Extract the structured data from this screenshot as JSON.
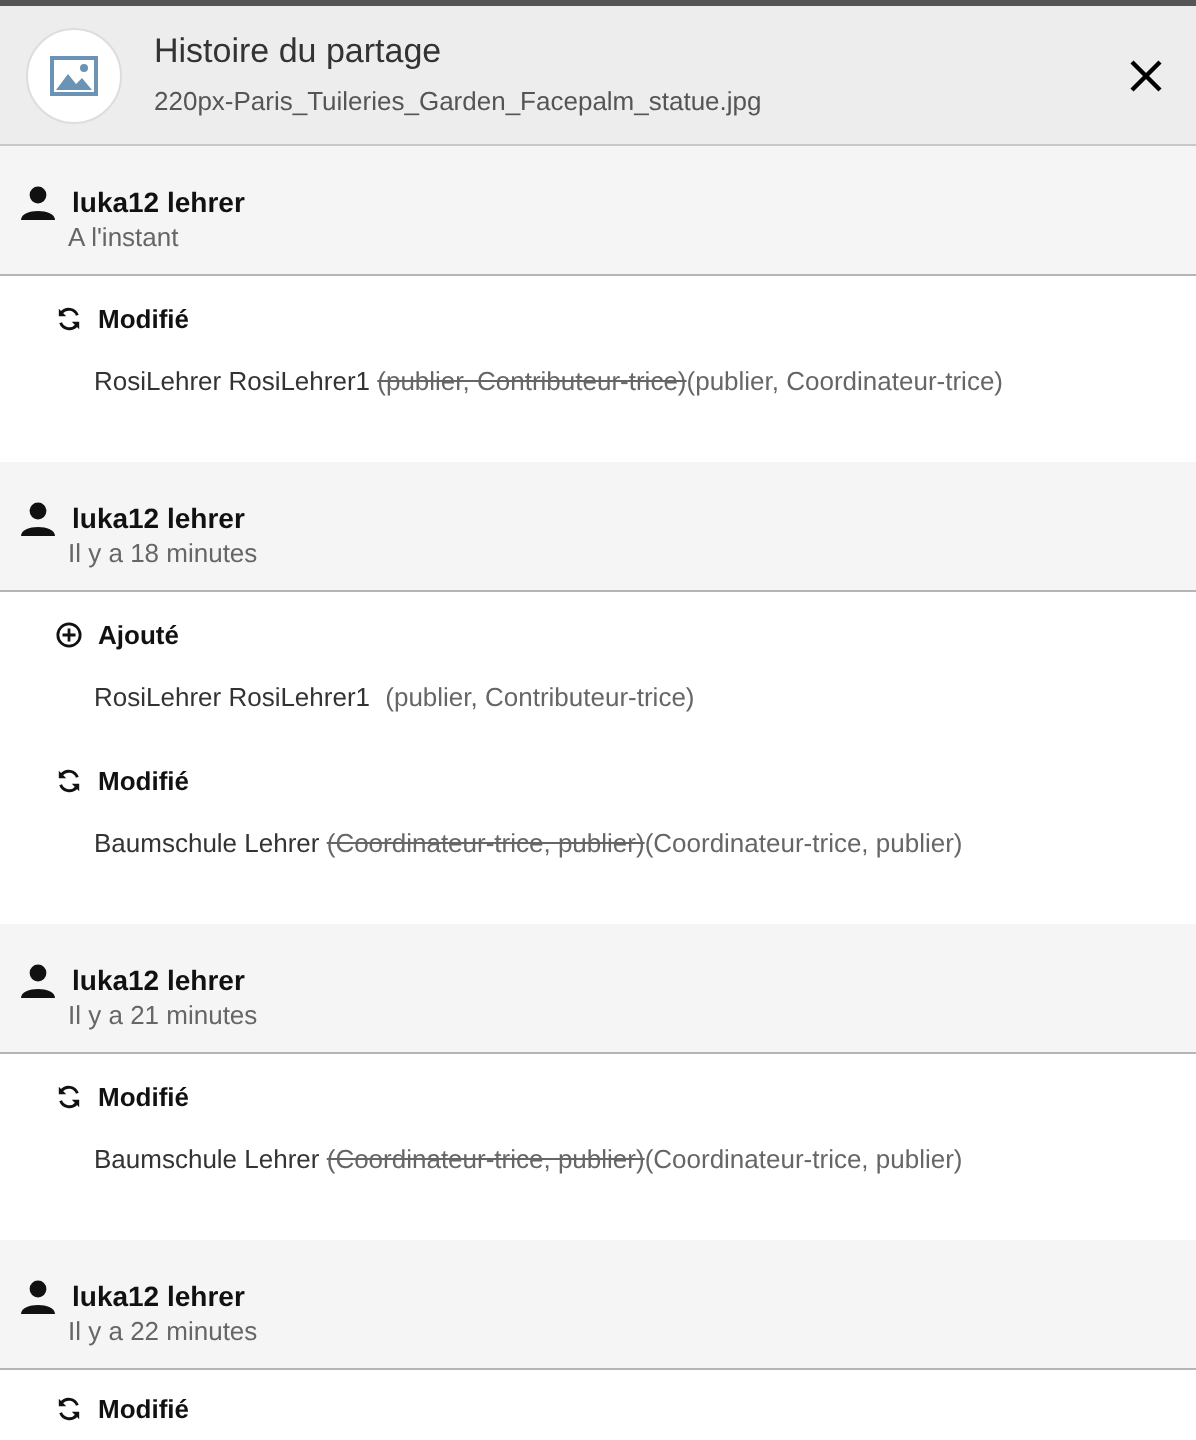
{
  "header": {
    "title": "Histoire du partage",
    "filename": "220px-Paris_Tuileries_Garden_Facepalm_statue.jpg"
  },
  "entries": [
    {
      "user": "luka12 lehrer",
      "time": "A l'instant",
      "changes": [
        {
          "kind": "modified",
          "label": "Modifié",
          "target": "RosiLehrer RosiLehrer1",
          "previous": "(publier, Contributeur-trice)",
          "current": "(publier, Coordinateur-trice)"
        }
      ]
    },
    {
      "user": "luka12 lehrer",
      "time": "Il y a 18 minutes",
      "changes": [
        {
          "kind": "added",
          "label": "Ajouté",
          "target": "RosiLehrer RosiLehrer1",
          "current": "(publier, Contributeur-trice)"
        },
        {
          "kind": "modified",
          "label": "Modifié",
          "target": "Baumschule Lehrer",
          "previous": "(Coordinateur-trice, publier)",
          "current": "(Coordinateur-trice, publier)"
        }
      ]
    },
    {
      "user": "luka12 lehrer",
      "time": "Il y a 21 minutes",
      "changes": [
        {
          "kind": "modified",
          "label": "Modifié",
          "target": "Baumschule Lehrer",
          "previous": "(Coordinateur-trice, publier)",
          "current": "(Coordinateur-trice, publier)"
        }
      ]
    },
    {
      "user": "luka12 lehrer",
      "time": "Il y a 22 minutes",
      "changes": [
        {
          "kind": "modified",
          "label": "Modifié"
        }
      ]
    }
  ]
}
